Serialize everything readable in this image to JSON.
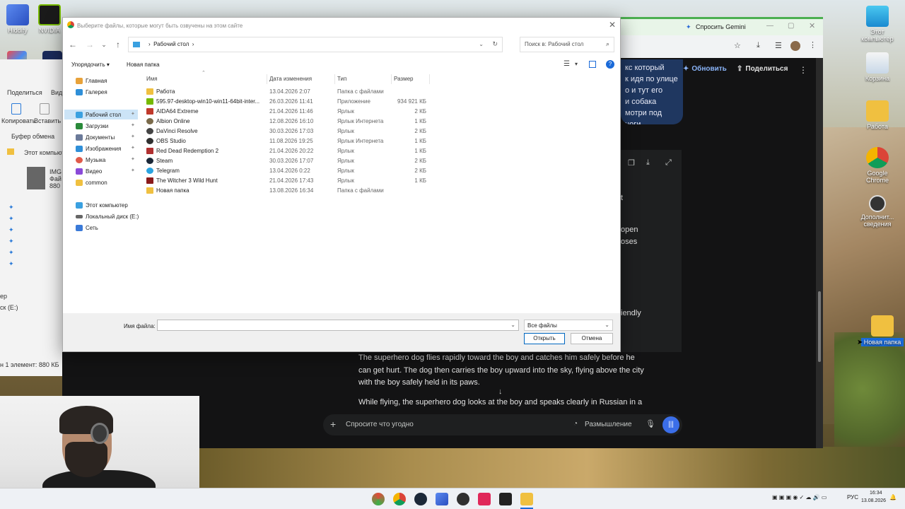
{
  "desktop": {
    "icons_right": [
      {
        "label": "Этот компьютер",
        "icon": "computer-icon"
      },
      {
        "label": "Корзина",
        "icon": "recycle-bin-icon"
      },
      {
        "label": "Работа",
        "icon": "folder-icon"
      },
      {
        "label": "Google Chrome",
        "icon": "chrome-icon"
      },
      {
        "label": "Дополнит... сведения",
        "icon": "info-icon"
      },
      {
        "label": "Новая папка",
        "icon": "folder-icon"
      }
    ],
    "icons_top_left": [
      {
        "label": "Hiddify",
        "icon": "hiddify-icon"
      },
      {
        "label": "NVIDIA",
        "icon": "nvidia-icon"
      }
    ]
  },
  "explorer_left": {
    "share": "Поделиться",
    "view_partial": "Вид",
    "copy": "Копировать",
    "paste": "Вставить",
    "clipboard": "Буфер обмена",
    "breadcrumb": "Этот компьют",
    "file_partial_1": "IMG",
    "file_partial_2": "Фай",
    "file_partial_3": "880",
    "side_partial_1": "ер",
    "side_partial_2": "ск (E:)",
    "status": "н 1 элемент: 880 КБ"
  },
  "browser": {
    "tab_title": "Спросить Gemini",
    "update": "Обновить",
    "share": "Поделиться",
    "bubble_lines": [
      "кс который",
      "к идя по улице",
      "о и тут его",
      "и собака",
      "мотри под ноги"
    ],
    "fragments": [
      "t",
      "open",
      "oses",
      "iendly"
    ],
    "response_para1": "The superhero dog flies rapidly toward the boy and catches him safely before he can get hurt. The dog then carries the boy upward into the sky, flying above the city with the boy safely held in its paws.",
    "response_para2": "While flying, the superhero dog looks at the boy and speaks clearly in Russian in a",
    "chat_placeholder": "Спросите что угодно",
    "thinking": "Размышление"
  },
  "dialog": {
    "title": "Выберите файлы, которые могут быть озвучены на этом сайте",
    "path_label": "Рабочий стол",
    "search_placeholder": "Поиск в: Рабочий стол",
    "organize": "Упорядочить",
    "new_folder": "Новая папка",
    "columns": {
      "name": "Имя",
      "modified": "Дата изменения",
      "type": "Тип",
      "size": "Размер"
    },
    "nav": [
      {
        "label": "Главная",
        "icon": "home-icon",
        "color": "#e8a23a"
      },
      {
        "label": "Галерея",
        "icon": "gallery-icon",
        "color": "#2f8fd8"
      },
      {
        "label": "Рабочий стол",
        "icon": "desktop-icon",
        "color": "#3aa0e0"
      },
      {
        "label": "Загрузки",
        "icon": "download-icon",
        "color": "#2a8a3a"
      },
      {
        "label": "Документы",
        "icon": "documents-icon",
        "color": "#6b7a99"
      },
      {
        "label": "Изображения",
        "icon": "pictures-icon",
        "color": "#2f8fd8"
      },
      {
        "label": "Музыка",
        "icon": "music-icon",
        "color": "#e05a4a"
      },
      {
        "label": "Видео",
        "icon": "video-icon",
        "color": "#8a4ad8"
      },
      {
        "label": "common",
        "icon": "folder-icon",
        "color": "#f0c040"
      },
      {
        "label": "Этот компьютер",
        "icon": "computer-icon",
        "color": "#3aa0e0"
      },
      {
        "label": "Локальный диск (E:)",
        "icon": "drive-icon",
        "color": "#666666"
      },
      {
        "label": "Сеть",
        "icon": "network-icon",
        "color": "#3a7ad8"
      }
    ],
    "files": [
      {
        "name": "Работа",
        "date": "13.04.2026 2:07",
        "type": "Папка с файлами",
        "size": "",
        "icon": "folder-icon",
        "color": "#f0c040"
      },
      {
        "name": "595.97-desktop-win10-win11-64bit-inter...",
        "date": "26.03.2026 11:41",
        "type": "Приложение",
        "size": "934 921 КБ",
        "icon": "nvidia-icon",
        "color": "#76b900"
      },
      {
        "name": "AIDA64 Extreme",
        "date": "21.04.2026 11:46",
        "type": "Ярлык",
        "size": "2 КБ",
        "icon": "aida64-icon",
        "color": "#c0392b"
      },
      {
        "name": "Albion Online",
        "date": "12.08.2026 16:10",
        "type": "Ярлык Интернета",
        "size": "1 КБ",
        "icon": "albion-icon",
        "color": "#7a6a4a"
      },
      {
        "name": "DaVinci Resolve",
        "date": "30.03.2026 17:03",
        "type": "Ярлык",
        "size": "2 КБ",
        "icon": "davinci-icon",
        "color": "#444444"
      },
      {
        "name": "OBS Studio",
        "date": "11.08.2026 19:25",
        "type": "Ярлык Интернета",
        "size": "1 КБ",
        "icon": "obs-icon",
        "color": "#303030"
      },
      {
        "name": "Red Dead Redemption 2",
        "date": "21.04.2026 20:22",
        "type": "Ярлык",
        "size": "1 КБ",
        "icon": "rdr2-icon",
        "color": "#b03030"
      },
      {
        "name": "Steam",
        "date": "30.03.2026 17:07",
        "type": "Ярлык",
        "size": "2 КБ",
        "icon": "steam-icon",
        "color": "#1b2838"
      },
      {
        "name": "Telegram",
        "date": "13.04.2026 0:22",
        "type": "Ярлык",
        "size": "2 КБ",
        "icon": "telegram-icon",
        "color": "#2aa3e0"
      },
      {
        "name": "The Witcher 3 Wild Hunt",
        "date": "21.04.2026 17:43",
        "type": "Ярлык",
        "size": "1 КБ",
        "icon": "witcher-icon",
        "color": "#8a1a1a"
      },
      {
        "name": "Новая папка",
        "date": "13.08.2026 16:34",
        "type": "Папка с файлами",
        "size": "",
        "icon": "folder-icon",
        "color": "#f0c040"
      }
    ],
    "filename_label": "Имя файла:",
    "filename_value": "",
    "filetype": "Все файлы",
    "open": "Открыть",
    "cancel": "Отмена"
  },
  "taskbar": {
    "lang": "РУС",
    "time": "16:34",
    "date": "13.08.2026"
  }
}
